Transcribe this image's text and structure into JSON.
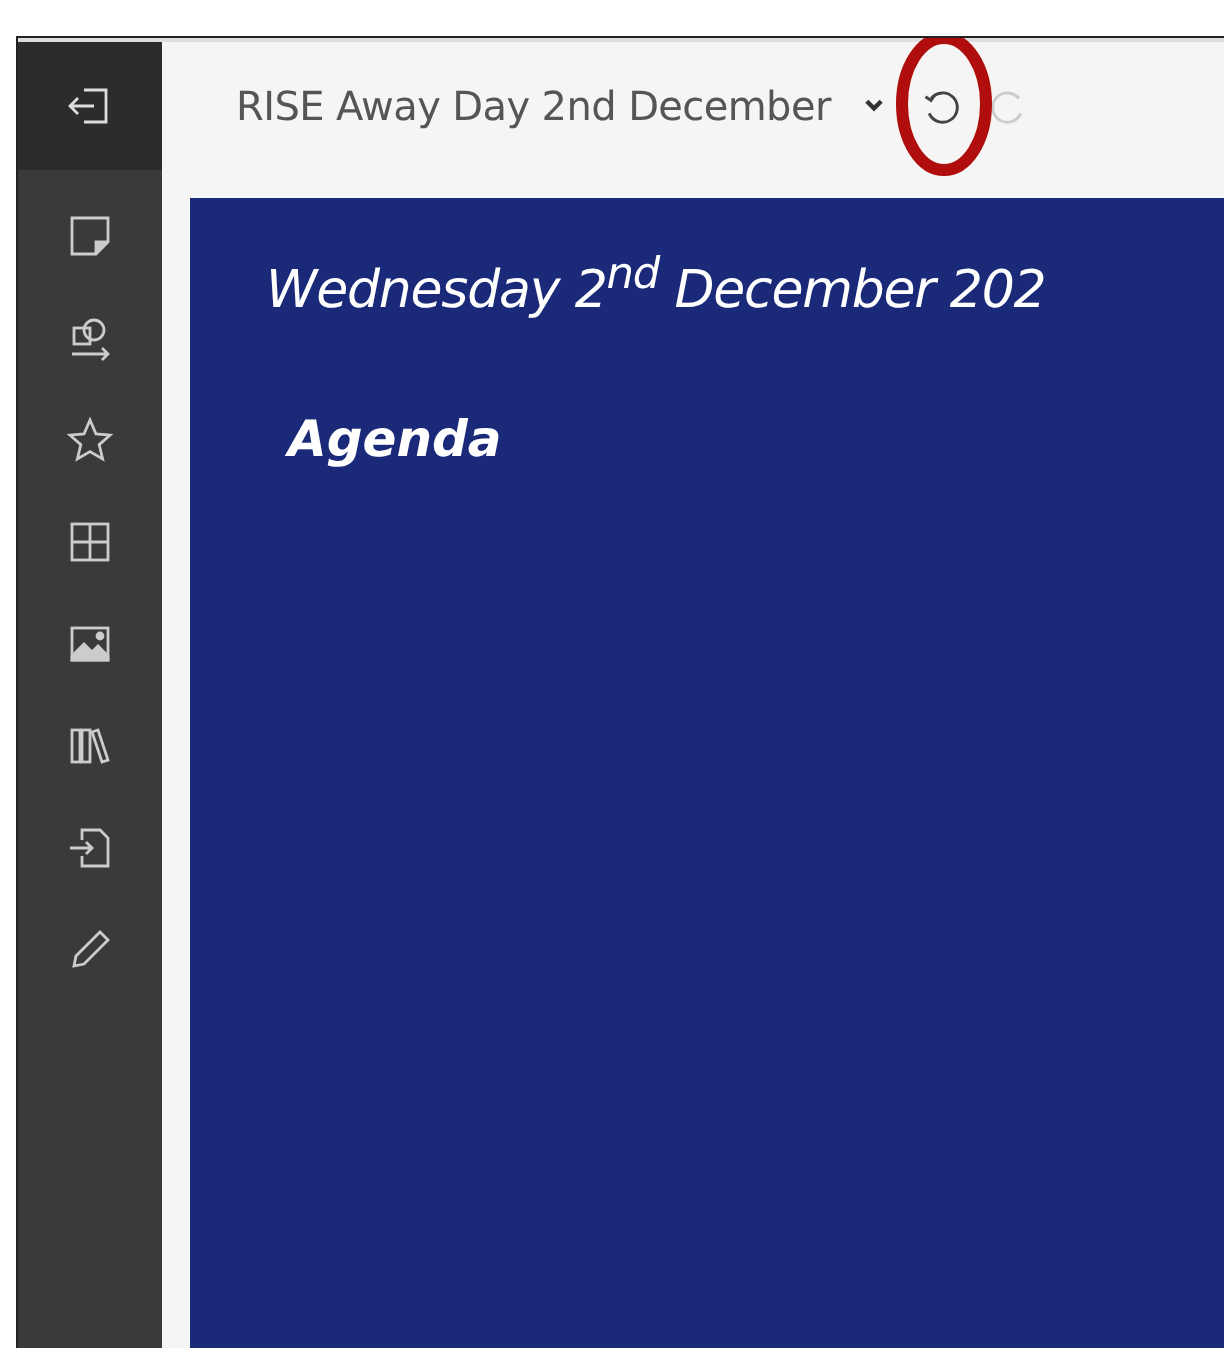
{
  "toolbar": {
    "title": "RISE Away Day 2nd December"
  },
  "slide": {
    "heading": "Wednesday 2$^{nd}$ December 202",
    "subheading": "Agenda"
  }
}
